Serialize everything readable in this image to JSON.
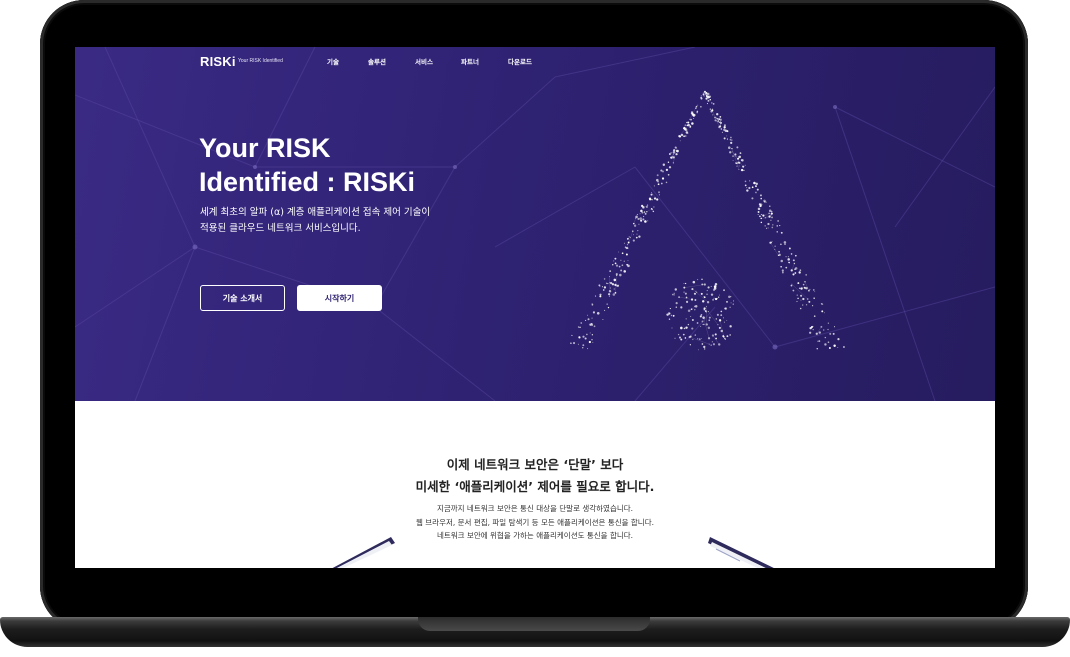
{
  "nav": {
    "logo": "RISKi",
    "tagline": "Your RISK Identified",
    "items": [
      "기술",
      "솔루션",
      "서비스",
      "파트너",
      "다운로드"
    ]
  },
  "hero": {
    "title_line1": "Your RISK",
    "title_line2": "Identified : RISKi",
    "desc_line1": "세계 최초의 알파 (α) 계층 애플리케이션 접속 제어 기술이",
    "desc_line2": "적용된 클라우드 네트워크 서비스입니다.",
    "btn_primary": "기술 소개서",
    "btn_secondary": "시작하기"
  },
  "section": {
    "heading_line1": "이제 네트워크 보안은 ‘단말’ 보다",
    "heading_line2": "미세한 ‘애플리케이션’ 제어를 필요로 합니다.",
    "desc_line1": "지금까지 네트워크 보안은 통신 대상을 단말로 생각하였습니다.",
    "desc_line2": "웹 브라우저, 문서 편집, 파일 탐색기 등 모든 애플리케이션은 통신을 합니다.",
    "desc_line3": "네트워크 보안에 위협을 가하는 애플리케이션도 통신을 합니다."
  },
  "colors": {
    "hero_bg": "#2f2273",
    "accent": "#3a2a84",
    "text_dark": "#222222",
    "white": "#ffffff"
  }
}
